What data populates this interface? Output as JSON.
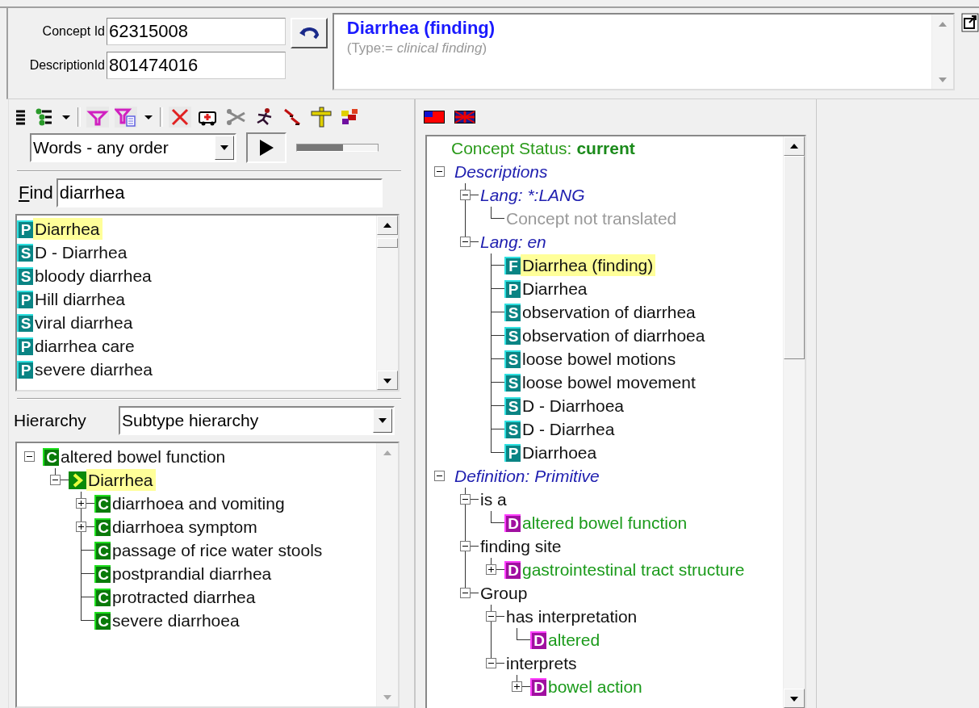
{
  "concept_id": {
    "label": "Concept Id",
    "value": "62315008"
  },
  "description_id": {
    "label": "DescriptionId",
    "value": "801474016"
  },
  "concept_header": {
    "title": "Diarrhea (finding)",
    "type_line": "(Type:= *clinical finding*)"
  },
  "search_mode": {
    "value": "Words - any order"
  },
  "search_slider": {
    "level": 0.57
  },
  "find": {
    "label": "Find",
    "value": "diarrhea"
  },
  "search_results": [
    {
      "badge": "P",
      "text": "Diarrhea",
      "selected": true
    },
    {
      "badge": "S",
      "text": "D - Diarrhea",
      "selected": false
    },
    {
      "badge": "S",
      "text": "bloody diarrhea",
      "selected": false
    },
    {
      "badge": "P",
      "text": "Hill diarrhea",
      "selected": false
    },
    {
      "badge": "S",
      "text": "viral diarrhea",
      "selected": false
    },
    {
      "badge": "P",
      "text": "diarrhea care",
      "selected": false
    },
    {
      "badge": "P",
      "text": "severe diarrhea",
      "selected": false
    }
  ],
  "hierarchy": {
    "label": "Hierarchy",
    "mode": "Subtype hierarchy",
    "tree": [
      {
        "kind": "concept",
        "badge": "C",
        "text": "altered bowel function",
        "expanded": true,
        "selected": false,
        "children": [
          {
            "kind": "focus",
            "text": "Diarrhea",
            "expanded": true,
            "selected": true,
            "children": [
              {
                "kind": "concept",
                "badge": "C",
                "text": "diarrhoea and vomiting",
                "expanded": false,
                "selected": false
              },
              {
                "kind": "concept",
                "badge": "C",
                "text": "diarrhoea symptom",
                "expanded": false,
                "selected": false
              },
              {
                "kind": "concept",
                "badge": "C",
                "text": "passage of rice water stools",
                "selected": false
              },
              {
                "kind": "concept",
                "badge": "C",
                "text": "postprandial diarrhea",
                "selected": false
              },
              {
                "kind": "concept",
                "badge": "C",
                "text": "protracted diarrhea",
                "selected": false
              },
              {
                "kind": "concept",
                "badge": "C",
                "text": "severe diarrhoea",
                "selected": false
              }
            ]
          }
        ]
      }
    ]
  },
  "details": {
    "status_label": "Concept Status:",
    "status_value": "current",
    "tree": [
      {
        "kind": "section",
        "text": "Descriptions",
        "expanded": true,
        "selected": false,
        "children": [
          {
            "kind": "lang",
            "text": "Lang: *:LANG",
            "expanded": true,
            "selected": false,
            "children": [
              {
                "kind": "note",
                "text": "Concept not translated",
                "selected": false
              }
            ]
          },
          {
            "kind": "lang",
            "text": "Lang: en",
            "expanded": true,
            "selected": false,
            "children": [
              {
                "kind": "description",
                "badge": "F",
                "text": "Diarrhea (finding)",
                "selected": true
              },
              {
                "kind": "description",
                "badge": "P",
                "text": "Diarrhea",
                "selected": false
              },
              {
                "kind": "description",
                "badge": "S",
                "text": "observation of diarrhea",
                "selected": false
              },
              {
                "kind": "description",
                "badge": "S",
                "text": "observation of diarrhoea",
                "selected": false
              },
              {
                "kind": "description",
                "badge": "S",
                "text": "loose bowel motions",
                "selected": false
              },
              {
                "kind": "description",
                "badge": "S",
                "text": "loose bowel movement",
                "selected": false
              },
              {
                "kind": "description",
                "badge": "S",
                "text": "D - Diarrhoea",
                "selected": false
              },
              {
                "kind": "description",
                "badge": "S",
                "text": "D - Diarrhea",
                "selected": false
              },
              {
                "kind": "description",
                "badge": "P",
                "text": "Diarrhoea",
                "selected": false
              }
            ]
          }
        ]
      },
      {
        "kind": "section",
        "text": "Definition: Primitive",
        "expanded": true,
        "selected": false,
        "children": [
          {
            "kind": "attribute",
            "text": "is a",
            "expanded": true,
            "selected": false,
            "children": [
              {
                "kind": "value",
                "badge": "D",
                "text": "altered bowel function",
                "selected": false
              }
            ]
          },
          {
            "kind": "attribute",
            "text": "finding site",
            "expanded": true,
            "selected": false,
            "children": [
              {
                "kind": "value",
                "badge": "D",
                "text": "gastrointestinal tract structure",
                "expanded": false,
                "selected": false
              }
            ]
          },
          {
            "kind": "attribute",
            "text": "Group",
            "expanded": true,
            "selected": false,
            "children": [
              {
                "kind": "attribute",
                "text": "has interpretation",
                "expanded": true,
                "selected": false,
                "children": [
                  {
                    "kind": "value",
                    "badge": "D",
                    "text": "altered",
                    "selected": false
                  }
                ]
              },
              {
                "kind": "attribute",
                "text": "interprets",
                "expanded": true,
                "selected": false,
                "children": [
                  {
                    "kind": "value",
                    "badge": "D",
                    "text": "bowel action",
                    "expanded": false,
                    "selected": false
                  }
                ]
              }
            ]
          }
        ]
      }
    ]
  }
}
